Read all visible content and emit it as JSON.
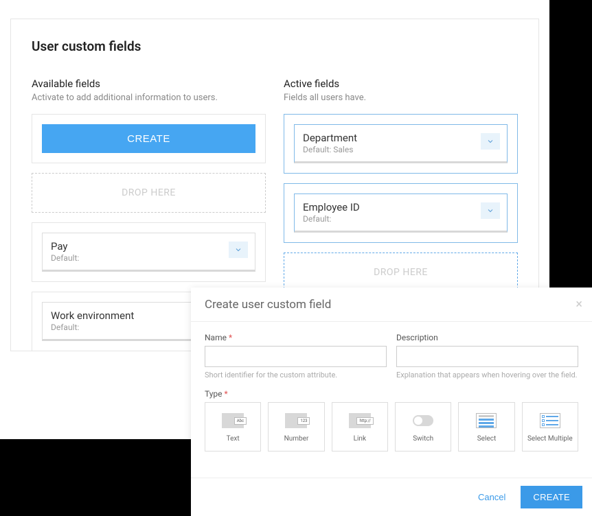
{
  "card": {
    "title": "User custom fields",
    "available": {
      "title": "Available fields",
      "subtitle": "Activate to add additional information to users.",
      "create_label": "CREATE",
      "drop_label": "DROP HERE",
      "fields": [
        {
          "name": "Pay",
          "default": "Default:"
        },
        {
          "name": "Work environment",
          "default": "Default:"
        }
      ]
    },
    "active": {
      "title": "Active fields",
      "subtitle": "Fields all users have.",
      "drop_label": "DROP HERE",
      "fields": [
        {
          "name": "Department",
          "default": "Default: Sales"
        },
        {
          "name": "Employee ID",
          "default": "Default:"
        }
      ]
    }
  },
  "modal": {
    "title": "Create user custom field",
    "name": {
      "label": "Name",
      "hint": "Short identifier for the custom attribute."
    },
    "description": {
      "label": "Description",
      "hint": "Explanation that appears when hovering over the field."
    },
    "type_label": "Type",
    "types": [
      {
        "label": "Text",
        "tag": "Abc"
      },
      {
        "label": "Number",
        "tag": "123"
      },
      {
        "label": "Link",
        "tag": "http://"
      },
      {
        "label": "Switch"
      },
      {
        "label": "Select"
      },
      {
        "label": "Select Multiple"
      }
    ],
    "cancel": "Cancel",
    "submit": "CREATE"
  }
}
